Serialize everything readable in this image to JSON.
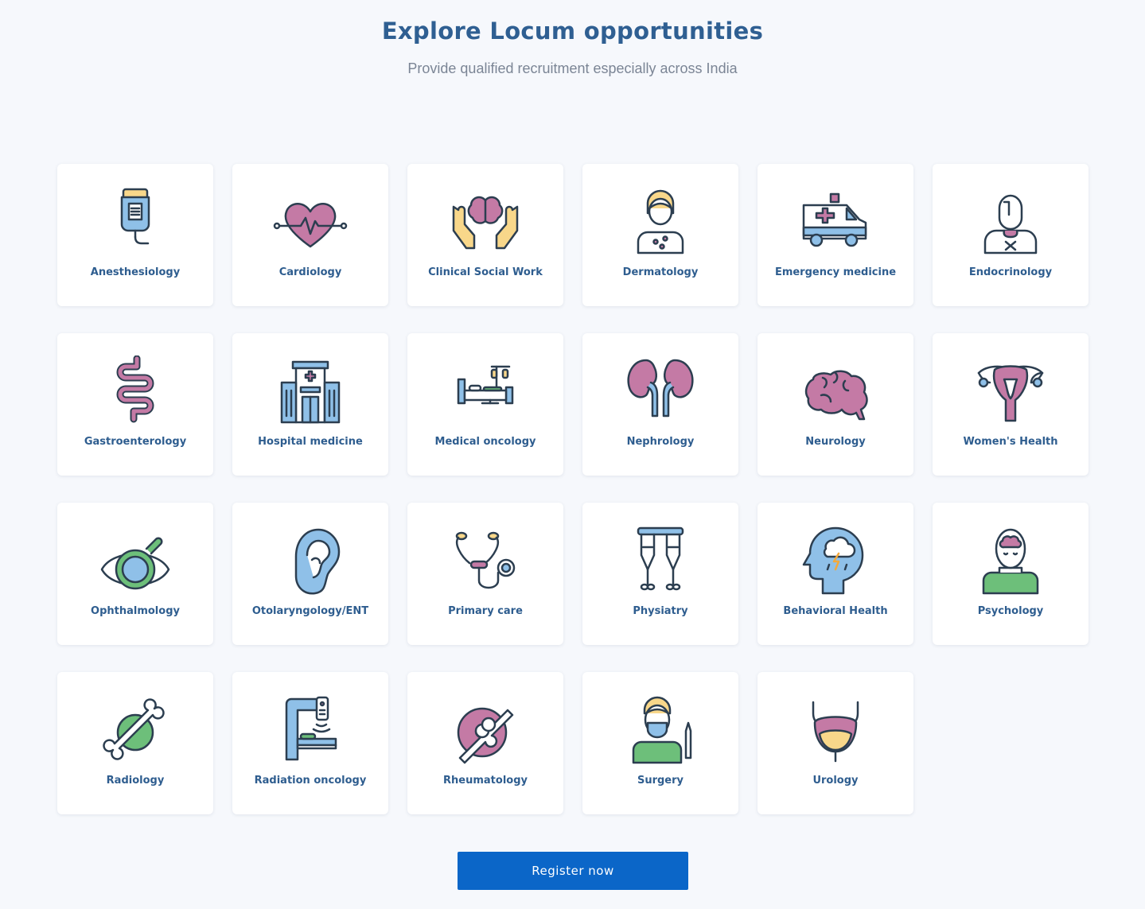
{
  "header": {
    "title": "Explore Locum opportunities",
    "subtitle": "Provide qualified recruitment especially across India"
  },
  "specialties": [
    {
      "label": "Anesthesiology",
      "icon": "iv-drip-icon"
    },
    {
      "label": "Cardiology",
      "icon": "heart-pulse-icon"
    },
    {
      "label": "Clinical Social Work",
      "icon": "hands-brain-icon"
    },
    {
      "label": "Dermatology",
      "icon": "dermatology-patient-icon"
    },
    {
      "label": "Emergency medicine",
      "icon": "ambulance-icon"
    },
    {
      "label": "Endocrinology",
      "icon": "thyroid-person-icon"
    },
    {
      "label": "Gastroenterology",
      "icon": "intestine-icon"
    },
    {
      "label": "Hospital medicine",
      "icon": "hospital-building-icon"
    },
    {
      "label": "Medical oncology",
      "icon": "hospital-bed-icon"
    },
    {
      "label": "Nephrology",
      "icon": "kidneys-icon"
    },
    {
      "label": "Neurology",
      "icon": "brain-icon"
    },
    {
      "label": "Women's Health",
      "icon": "uterus-icon"
    },
    {
      "label": "Ophthalmology",
      "icon": "eye-icon"
    },
    {
      "label": "Otolaryngology/ENT",
      "icon": "ear-icon"
    },
    {
      "label": "Primary care",
      "icon": "stethoscope-icon"
    },
    {
      "label": "Physiatry",
      "icon": "crutches-icon"
    },
    {
      "label": "Behavioral Health",
      "icon": "head-storm-icon"
    },
    {
      "label": "Psychology",
      "icon": "person-brain-icon"
    },
    {
      "label": "Radiology",
      "icon": "bone-scan-icon"
    },
    {
      "label": "Radiation oncology",
      "icon": "radiation-machine-icon"
    },
    {
      "label": "Rheumatology",
      "icon": "joint-bone-icon"
    },
    {
      "label": "Surgery",
      "icon": "surgeon-icon"
    },
    {
      "label": "Urology",
      "icon": "bladder-icon"
    }
  ],
  "register_button": {
    "label": "Register now"
  },
  "colors": {
    "background": "#f6f8fc",
    "title": "#2f5f92",
    "subtitle": "#7b8595",
    "card_label": "#2e5d8f",
    "button": "#0b66c8",
    "icon_outline": "#2c3e50",
    "icon_pink": "#c47aa5",
    "icon_blue": "#8fc0e8",
    "icon_green": "#6dbf7a",
    "icon_yellow": "#f8d78a"
  }
}
